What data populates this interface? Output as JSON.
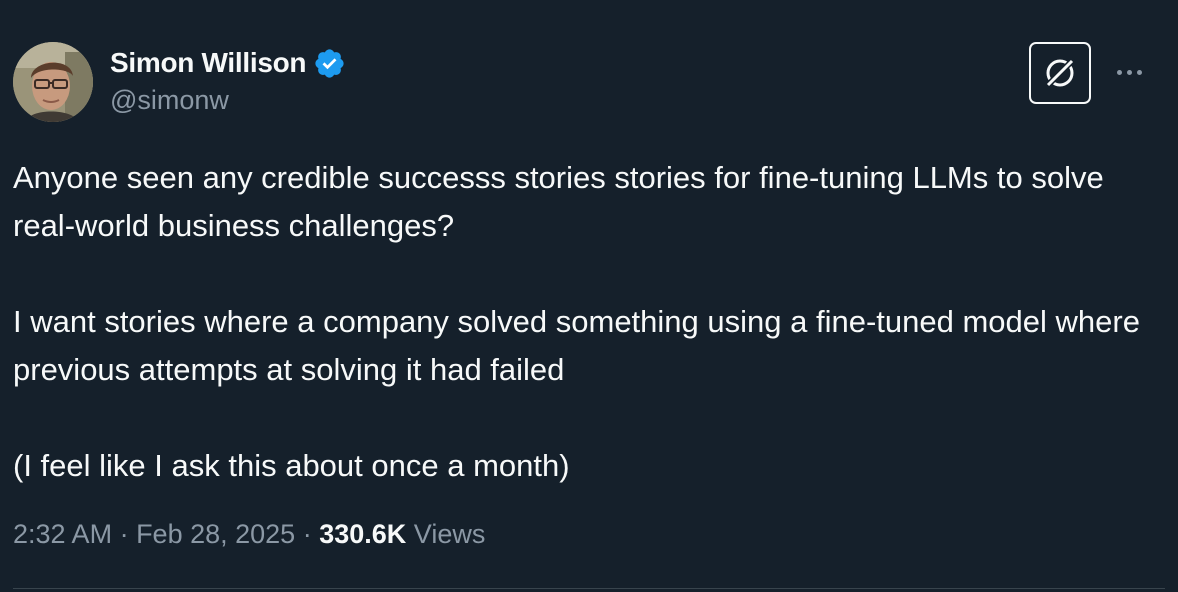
{
  "author": {
    "display_name": "Simon Willison",
    "handle": "@simonw",
    "verified_icon": "verified-badge-icon"
  },
  "header": {
    "grok_icon": "grok-icon",
    "more_icon": "more-options-icon"
  },
  "tweet": {
    "paragraphs": [
      "Anyone seen any credible successs stories stories for fine-tuning LLMs to solve real-world business challenges?",
      "I want stories where a company solved something using a fine-tuned model where previous attempts at solving it had failed",
      "(I feel like I ask this about once a month)"
    ]
  },
  "meta": {
    "time": "2:32 AM",
    "separator": " · ",
    "date": "Feb 28, 2025",
    "views_count": "330.6K",
    "views_label": "Views"
  },
  "colors": {
    "background": "#15202b",
    "text": "#f7f9f9",
    "secondary": "#8b98a5",
    "verified": "#1d9bf0"
  }
}
